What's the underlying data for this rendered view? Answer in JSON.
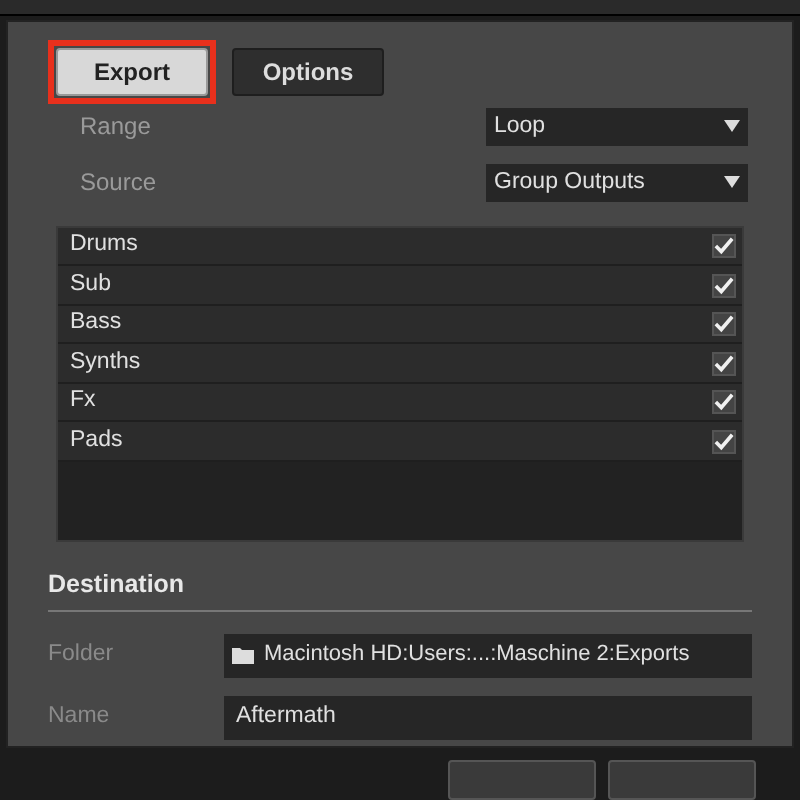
{
  "tabs": [
    {
      "label": "Export",
      "selected": true,
      "highlighted": true
    },
    {
      "label": "Options",
      "selected": false,
      "highlighted": false
    }
  ],
  "fields": [
    {
      "label": "Range",
      "value": "Loop"
    },
    {
      "label": "Source",
      "value": "Group Outputs"
    }
  ],
  "sources": [
    {
      "name": "Drums",
      "checked": true
    },
    {
      "name": "Sub",
      "checked": true
    },
    {
      "name": "Bass",
      "checked": true
    },
    {
      "name": "Synths",
      "checked": true
    },
    {
      "name": "Fx",
      "checked": true
    },
    {
      "name": "Pads",
      "checked": true
    }
  ],
  "destination": {
    "heading": "Destination",
    "folder_label": "Folder",
    "folder": "Macintosh HD:Users:...:Maschine 2:Exports",
    "name_label": "Name",
    "name": "Aftermath"
  }
}
